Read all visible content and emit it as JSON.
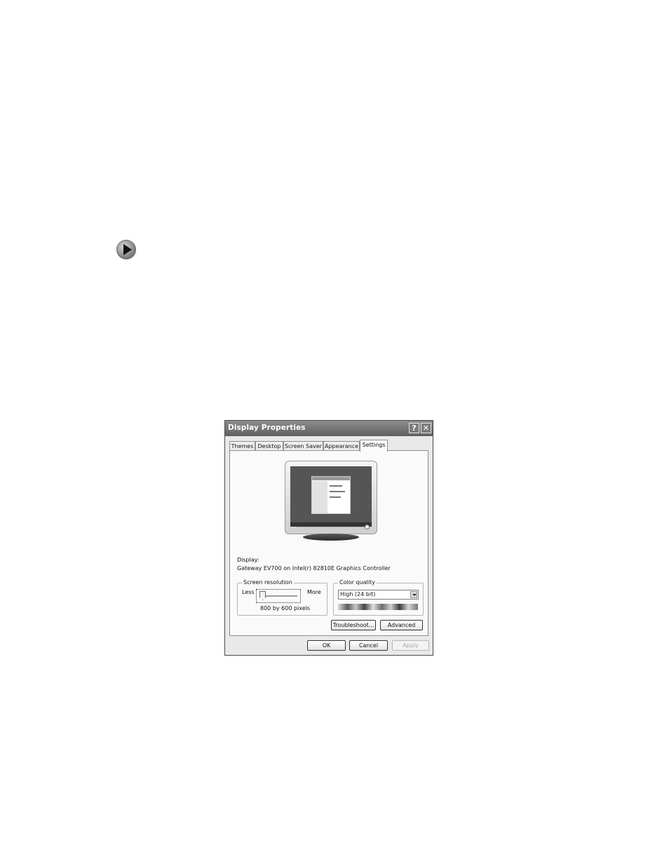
{
  "dialog": {
    "title": "Display Properties",
    "help_button": "?",
    "close_button": "✕",
    "tabs": [
      "Themes",
      "Desktop",
      "Screen Saver",
      "Appearance",
      "Settings"
    ],
    "active_tab": "Settings"
  },
  "settings": {
    "display_label": "Display:",
    "display_value": "Gateway EV700 on Intel(r) 82810E Graphics Controller",
    "screen_resolution": {
      "legend": "Screen resolution",
      "less_label": "Less",
      "more_label": "More",
      "value_text": "800 by 600 pixels",
      "slider_position": 0
    },
    "color_quality": {
      "legend": "Color quality",
      "selected": "High (24 bit)"
    },
    "troubleshoot_label": "Troubleshoot...",
    "advanced_label": "Advanced"
  },
  "footer": {
    "ok_label": "OK",
    "cancel_label": "Cancel",
    "apply_label": "Apply"
  }
}
